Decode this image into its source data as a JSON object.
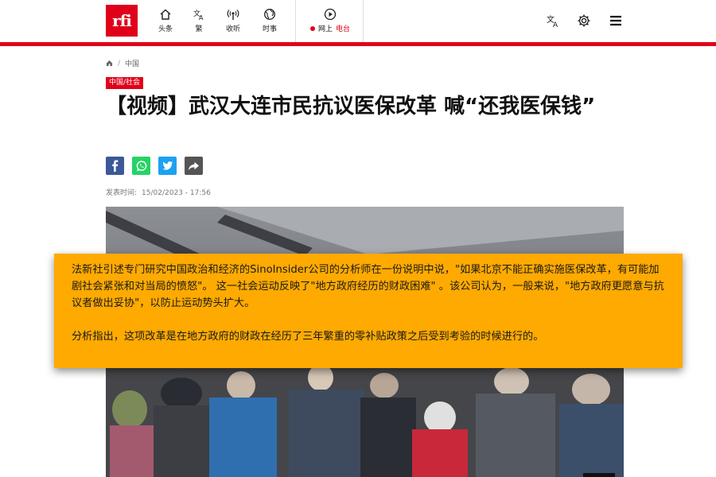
{
  "header": {
    "logo_text": "rfi",
    "nav": [
      {
        "label": "头条",
        "icon": "home-icon"
      },
      {
        "label": "繁",
        "icon": "translate-icon"
      },
      {
        "label": "收听",
        "icon": "radio-icon"
      },
      {
        "label": "时事",
        "icon": "globe-icon"
      }
    ],
    "live": {
      "label": "网上",
      "station": "电台",
      "icon": "play-icon"
    },
    "right_icons": [
      "translate-icon",
      "gear-icon",
      "menu-icon"
    ],
    "accent_color": "#e0001a"
  },
  "breadcrumb": {
    "home_icon": "home-icon",
    "current": "中国"
  },
  "article": {
    "category": "中国/社会",
    "title": "【视频】武汉大连市民抗议医保改革 喊“还我医保钱”",
    "share_icons": [
      "facebook-icon",
      "whatsapp-icon",
      "twitter-icon",
      "share-icon"
    ],
    "date_label": "发表时间:",
    "date_value": "15/02/2023 - 17:56"
  },
  "overlay": {
    "paragraph1": "法新社引述专门研究中国政治和经济的SinoInsider公司的分析师在一份说明中说，\"如果北京不能正确实施医保改革，有可能加剧社会紧张和对当局的愤怒\"。 这一社会运动反映了\"地方政府经历的财政困难\" 。该公司认为，一般来说，\"地方政府更愿意与抗议者做出妥协\"，以防止运动势头扩大。",
    "paragraph2": "分析指出，这项改革是在地方政府的财政在经历了三年繁重的零补贴政策之后受到考验的时候进行的。",
    "background_color": "#ffaa00"
  }
}
